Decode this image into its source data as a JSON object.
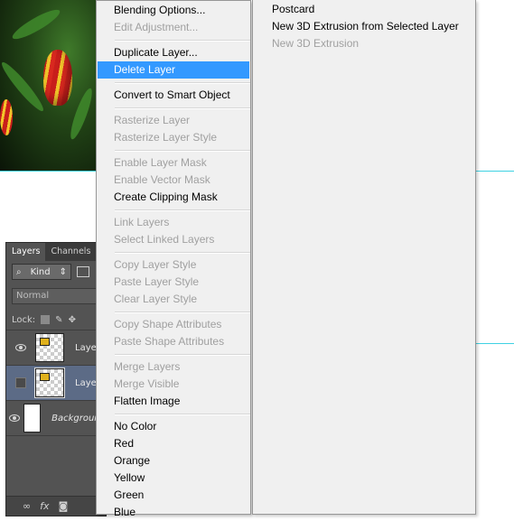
{
  "context_menu": {
    "items": [
      {
        "label": "Blending Options...",
        "enabled": true
      },
      {
        "label": "Edit Adjustment...",
        "enabled": false
      },
      {
        "label": "Duplicate Layer...",
        "enabled": true
      },
      {
        "label": "Delete Layer",
        "enabled": true,
        "highlighted": true
      },
      {
        "label": "Convert to Smart Object",
        "enabled": true
      },
      {
        "label": "Rasterize Layer",
        "enabled": false
      },
      {
        "label": "Rasterize Layer Style",
        "enabled": false
      },
      {
        "label": "Enable Layer Mask",
        "enabled": false
      },
      {
        "label": "Enable Vector Mask",
        "enabled": false
      },
      {
        "label": "Create Clipping Mask",
        "enabled": true
      },
      {
        "label": "Link Layers",
        "enabled": false
      },
      {
        "label": "Select Linked Layers",
        "enabled": false
      },
      {
        "label": "Copy Layer Style",
        "enabled": false
      },
      {
        "label": "Paste Layer Style",
        "enabled": false
      },
      {
        "label": "Clear Layer Style",
        "enabled": false
      },
      {
        "label": "Copy Shape Attributes",
        "enabled": false
      },
      {
        "label": "Paste Shape Attributes",
        "enabled": false
      },
      {
        "label": "Merge Layers",
        "enabled": false
      },
      {
        "label": "Merge Visible",
        "enabled": false
      },
      {
        "label": "Flatten Image",
        "enabled": true
      },
      {
        "label": "No Color",
        "enabled": true
      },
      {
        "label": "Red",
        "enabled": true
      },
      {
        "label": "Orange",
        "enabled": true
      },
      {
        "label": "Yellow",
        "enabled": true
      },
      {
        "label": "Green",
        "enabled": true
      },
      {
        "label": "Blue",
        "enabled": true
      }
    ]
  },
  "submenu": {
    "items": [
      {
        "label": "Postcard",
        "enabled": true
      },
      {
        "label": "New 3D Extrusion from Selected Layer",
        "enabled": true
      },
      {
        "label": "New 3D Extrusion",
        "enabled": false
      }
    ]
  },
  "layers_panel": {
    "tabs": [
      "Layers",
      "Channels"
    ],
    "filter_kind": "Kind",
    "blend_mode": "Normal",
    "lock_label": "Lock:",
    "layers": [
      {
        "name": "Layer",
        "visible": true,
        "selected": false
      },
      {
        "name": "Layer",
        "visible": false,
        "selected": true
      },
      {
        "name": "Background",
        "visible": true,
        "selected": false
      }
    ],
    "bottom_fx_label": "fx"
  },
  "colors": {
    "highlight": "#3399ff",
    "menu_bg": "#f0f0f0",
    "panel_bg": "#535353",
    "guide": "#3fd2e3"
  }
}
